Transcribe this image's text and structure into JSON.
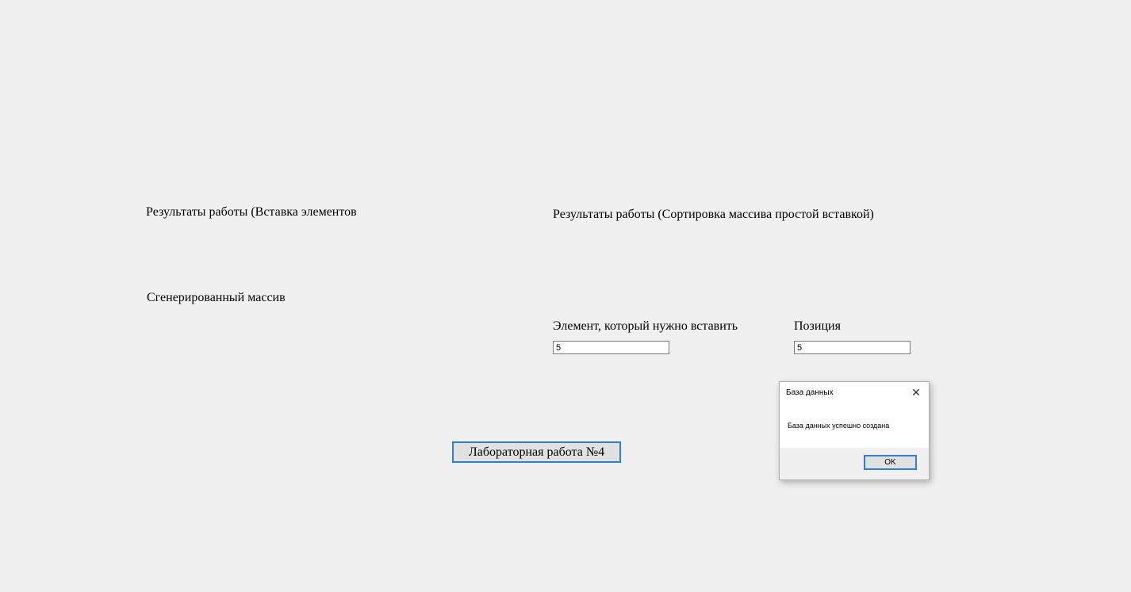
{
  "labels": {
    "results_insert": "Результаты работы (Вставка элементов",
    "results_sort": "Результаты работы (Сортировка массива простой вставкой)",
    "generated_array": "Сгенерированный массив",
    "element_to_insert": "Элемент, который нужно вставить",
    "position": "Позиция"
  },
  "inputs": {
    "element_value": "5",
    "position_value": "5"
  },
  "buttons": {
    "lab_work": "Лабораторная работа №4"
  },
  "dialog": {
    "title": "База данных",
    "close_glyph": "✕",
    "message": "База данных успешно создана",
    "ok_label": "OK"
  }
}
